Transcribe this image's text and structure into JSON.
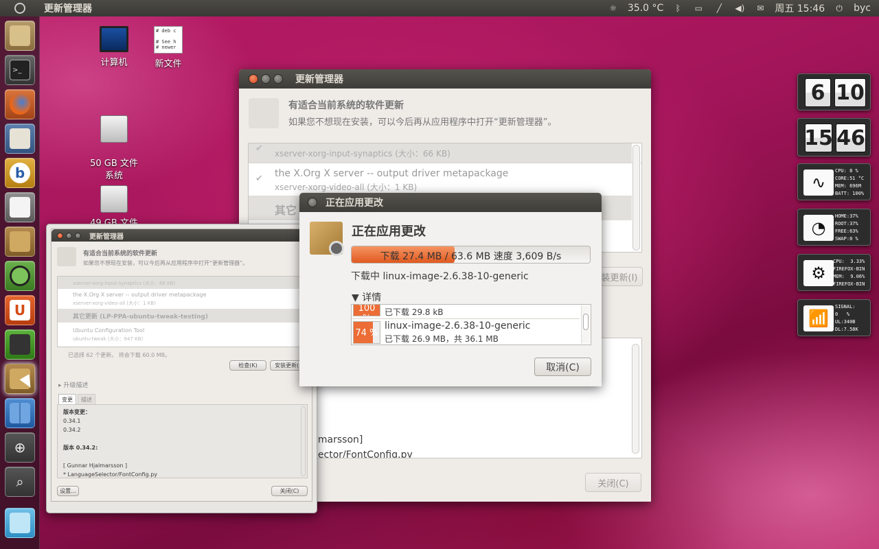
{
  "panel": {
    "app_title": "更新管理器",
    "temperature": "35.0 °C",
    "datetime": "周五 15:46",
    "user": "byc"
  },
  "desktop": {
    "icons": [
      {
        "label": "计算机"
      },
      {
        "label": "新文件",
        "preview": "# deb c\n\n# See h\n# newer"
      },
      {
        "label": "50 GB 文件\n系统"
      },
      {
        "label": "49 GB 文件"
      }
    ]
  },
  "main_window": {
    "title": "更新管理器",
    "heading": "有适合当前系统的软件更新",
    "subtext": "如果您不想现在安装，可以今后再从应用程序中打开“更新管理器”。",
    "rows": [
      {
        "name": "",
        "pkg": "xserver-xorg-input-synaptics (大小：66 KB)"
      },
      {
        "name": "the X.Org X server -- output driver metapackage",
        "pkg": "xserver-xorg-video-all (大小：1 KB)"
      },
      {
        "group": "其它"
      }
    ],
    "install_btn": "装更新(I)",
    "changelog_fragment_1": "lmarsson]",
    "changelog_fragment_2": "lector/FontConfig.py",
    "close_btn": "关闭(C)"
  },
  "progress_dialog": {
    "title": "正在应用更改",
    "heading": "正在应用更改",
    "progress_text": "下载 27.4 MB / 63.6 MB 速度 3,609 B/s",
    "progress_fraction": 0.431,
    "current": "下载中 linux-image-2.6.38-10-generic",
    "details_label": "▼ 详情",
    "items": [
      {
        "percent": "100 %",
        "fraction": 1.0,
        "name": "",
        "sub": "已下载 29.8 kB"
      },
      {
        "percent": "74 %",
        "fraction": 0.74,
        "name": "linux-image-2.6.38-10-generic",
        "sub": "已下载 26.9 MB，共 36.1 MB"
      }
    ],
    "cancel_btn": "取消(C)"
  },
  "small_window": {
    "title": "更新管理器",
    "heading": "有适合当前系统的软件更新",
    "subtext": "如果您不想现在安装，可以今后再从应用程序中打开“更新管理器”。",
    "rows": [
      {
        "name": "",
        "pkg": "xserver-xorg-input-synaptics (大小：66 KB)",
        "checked": true
      },
      {
        "name": "the X.Org X server -- output driver metapackage",
        "pkg": "xserver-xorg-video-all (大小：1 KB)",
        "checked": true
      },
      {
        "group": "其它更新 (LP-PPA-ubuntu-tweak-testing)"
      },
      {
        "name": "Ubuntu Configuration Tool",
        "pkg": "ubuntu-tweak (大小：947 KB)",
        "checked": false
      }
    ],
    "selected_text": "已选择 62 个更新。 将会下载 60.0 MB。",
    "check_btn": "检查(K)",
    "install_btn": "安装更新(I)",
    "expander": "▸ 升级描述",
    "tabs": [
      "变更",
      "描述"
    ],
    "changelog": [
      "版本变更：",
      "0.34.1",
      "0.34.2",
      "",
      "版本 0.34.2:",
      "",
      "[ Gunnar Hjalmarsson ]",
      "* LanguageSelector/FontConfig.py"
    ],
    "settings_btn": "设置...",
    "close_btn": "关闭(C)"
  },
  "widgets": {
    "clock_date": [
      "6",
      "10"
    ],
    "clock_time": [
      "15",
      "46"
    ],
    "sys": "CPU: 8 %\nCORE:51 °C\nMEM: 696M\nBATT: 100%",
    "disk": "HOME:37%\nROOT:37%\nFREE:63%\nSWAP:0 %",
    "proc": "CPU:  3.33%\nFIREFOX-BIN\nMEM:  9.06%\nFIREFOX-BIN",
    "net": "SIGNAL:\n0   %\nUL:340B\nDL:7.58K"
  },
  "colors": {
    "accent": "#f07746",
    "panel": "#3c3b37",
    "window_bg": "#efece8"
  }
}
